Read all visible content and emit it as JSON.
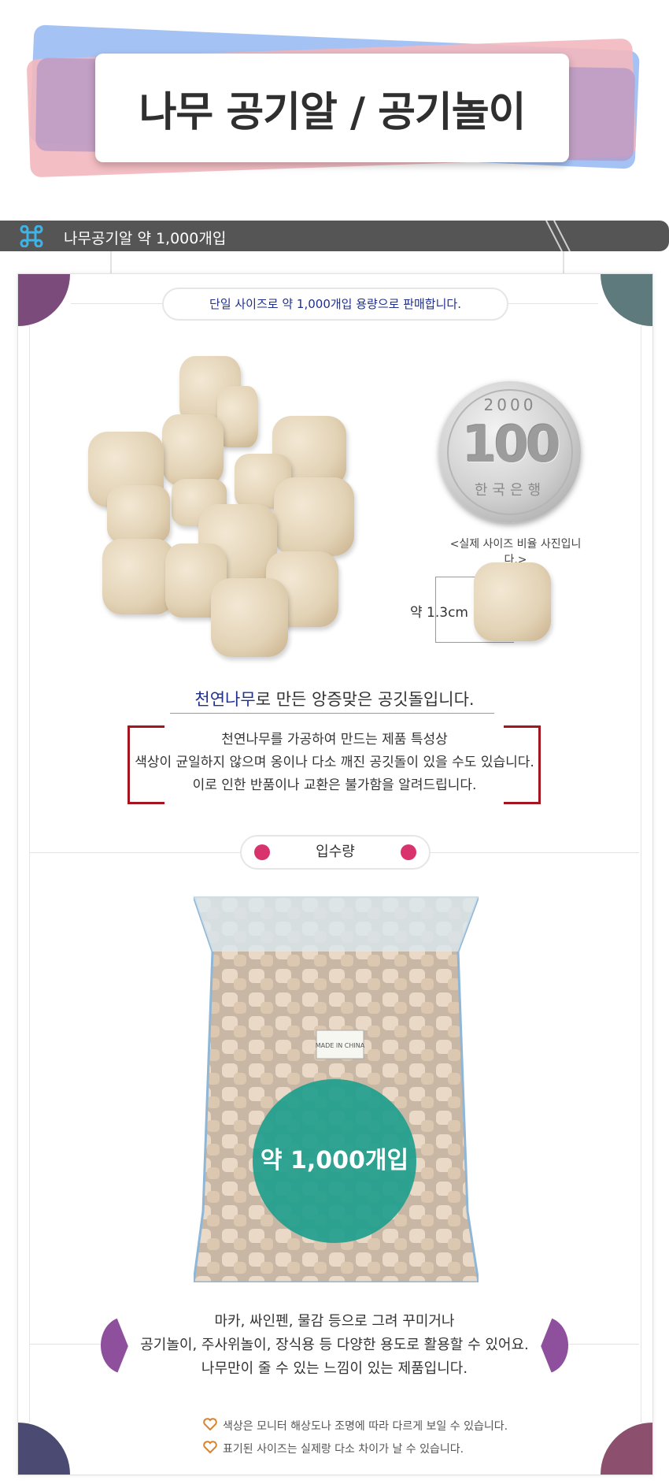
{
  "header": {
    "title": "나무 공기알 / 공기놀이"
  },
  "section": {
    "label": "나무공기알 약 1,000개입"
  },
  "intro": {
    "sale_note": "단일 사이즈로 약 1,000개입 용량으로 판매합니다."
  },
  "coin": {
    "year": "2000",
    "value": "100",
    "country": "한국은행"
  },
  "size": {
    "caption": "<실제 사이즈 비율 사진입니다.>",
    "measure": "약 1.3cm"
  },
  "material": {
    "highlight": "천연나무",
    "rest": "로 만든 앙증맞은 공깃돌입니다."
  },
  "notice": {
    "lines": [
      "천연나무를 가공하여 만드는 제품 특성상",
      "색상이 균일하지 않으며 옹이나 다소 깨진 공깃돌이 있을 수도 있습니다.",
      "이로 인한 반품이나 교환은 불가함을 알려드립니다."
    ]
  },
  "quantity": {
    "heading": "입수량",
    "badge": "약 1,000개입",
    "bag_label": "MADE IN CHINA"
  },
  "usage": {
    "lines": [
      "마카, 싸인펜, 물감 등으로 그려 꾸미거나",
      "공기놀이, 주사위놀이, 장식용 등 다양한 용도로 활용할 수 있어요.",
      "나무만이 줄 수 있는 느낌이 있는 제품입니다."
    ]
  },
  "footnotes": [
    "색상은 모니터 해상도나 조명에 따라 다르게 보일 수 있습니다.",
    "표기된 사이즈는 실제랑 다소 차이가 날 수 있습니다."
  ],
  "colors": {
    "brand_blue": "#1f2f8c",
    "bracket_red": "#a4161f",
    "teal_badge": "#1f9e8d",
    "pink_dot": "#d9336e",
    "purple_accent": "#8e4f9c",
    "heart_orange": "#d8842e"
  },
  "icons": [
    "command-icon",
    "heart-icon"
  ]
}
